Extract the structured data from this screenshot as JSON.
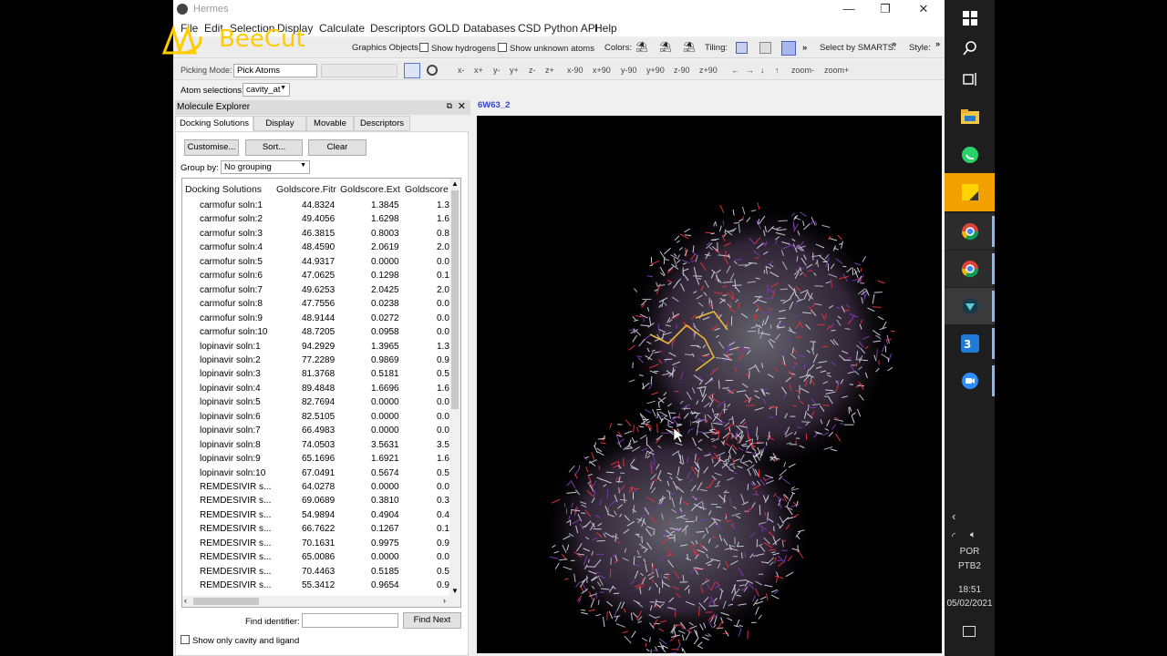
{
  "window": {
    "title": "Hermes",
    "minimize": "—",
    "maximize": "❐",
    "close": "✕"
  },
  "menu": [
    "File",
    "Edit",
    "Selection",
    "Display",
    "Calculate",
    "Descriptors",
    "GOLD",
    "Databases",
    "CSD Python API",
    "Help"
  ],
  "toolbar1": {
    "show_hydrogens": "Show hydrogens",
    "show_unknown_atoms": "Show unknown atoms",
    "graphics_objects": "Graphics Objects",
    "colors": "Colors:",
    "tiling": "Tiling:",
    "select_smarts": "Select by SMARTS:",
    "style": "Style:",
    "more": "»"
  },
  "toolbar2": {
    "picking_mode_label": "Picking Mode:",
    "picking_mode_value": "Pick Atoms",
    "rotations": [
      "x-",
      "x+",
      "y-",
      "y+",
      "z-",
      "z+",
      "x-90",
      "x+90",
      "y-90",
      "y+90",
      "z-90",
      "z+90",
      "←",
      "→",
      "↓",
      "↑",
      "zoom-",
      "zoom+"
    ]
  },
  "atom_selections": {
    "label": "Atom selections:",
    "value": "cavity_at"
  },
  "molecule_explorer": {
    "title": "Molecule Explorer",
    "tabs": [
      "Docking Solutions",
      "Display",
      "Movable",
      "Descriptors"
    ],
    "buttons": {
      "customise": "Customise...",
      "sort": "Sort...",
      "clear": "Clear"
    },
    "group_by_label": "Group by:",
    "group_by_value": "No grouping",
    "columns": [
      "Docking Solutions",
      "Goldscore.Fitr",
      "Goldscore.Ext",
      "Goldscore"
    ],
    "rows": [
      [
        "carmofur soln:1",
        "44.8324",
        "1.3845",
        "1.3"
      ],
      [
        "carmofur soln:2",
        "49.4056",
        "1.6298",
        "1.6"
      ],
      [
        "carmofur soln:3",
        "46.3815",
        "0.8003",
        "0.8"
      ],
      [
        "carmofur soln:4",
        "48.4590",
        "2.0619",
        "2.0"
      ],
      [
        "carmofur soln:5",
        "44.9317",
        "0.0000",
        "0.0"
      ],
      [
        "carmofur soln:6",
        "47.0625",
        "0.1298",
        "0.1"
      ],
      [
        "carmofur soln:7",
        "49.6253",
        "2.0425",
        "2.0"
      ],
      [
        "carmofur soln:8",
        "47.7556",
        "0.0238",
        "0.0"
      ],
      [
        "carmofur soln:9",
        "48.9144",
        "0.0272",
        "0.0"
      ],
      [
        "carmofur soln:10",
        "48.7205",
        "0.0958",
        "0.0"
      ],
      [
        "lopinavir soln:1",
        "94.2929",
        "1.3965",
        "1.3"
      ],
      [
        "lopinavir soln:2",
        "77.2289",
        "0.9869",
        "0.9"
      ],
      [
        "lopinavir soln:3",
        "81.3768",
        "0.5181",
        "0.5"
      ],
      [
        "lopinavir soln:4",
        "89.4848",
        "1.6696",
        "1.6"
      ],
      [
        "lopinavir soln:5",
        "82.7694",
        "0.0000",
        "0.0"
      ],
      [
        "lopinavir soln:6",
        "82.5105",
        "0.0000",
        "0.0"
      ],
      [
        "lopinavir soln:7",
        "66.4983",
        "0.0000",
        "0.0"
      ],
      [
        "lopinavir soln:8",
        "74.0503",
        "3.5631",
        "3.5"
      ],
      [
        "lopinavir soln:9",
        "65.1696",
        "1.6921",
        "1.6"
      ],
      [
        "lopinavir soln:10",
        "67.0491",
        "0.5674",
        "0.5"
      ],
      [
        "REMDESIVIR s...",
        "64.0278",
        "0.0000",
        "0.0"
      ],
      [
        "REMDESIVIR s...",
        "69.0689",
        "0.3810",
        "0.3"
      ],
      [
        "REMDESIVIR s...",
        "54.9894",
        "0.4904",
        "0.4"
      ],
      [
        "REMDESIVIR s...",
        "66.7622",
        "0.1267",
        "0.1"
      ],
      [
        "REMDESIVIR s...",
        "70.1631",
        "0.9975",
        "0.9"
      ],
      [
        "REMDESIVIR s...",
        "65.0086",
        "0.0000",
        "0.0"
      ],
      [
        "REMDESIVIR s...",
        "70.4463",
        "0.5185",
        "0.5"
      ],
      [
        "REMDESIVIR s...",
        "55.3412",
        "0.9654",
        "0.9"
      ]
    ],
    "find_identifier_label": "Find identifier:",
    "find_identifier_value": "",
    "find_next": "Find Next",
    "show_only_cavity": "Show only cavity and ligand"
  },
  "viewer": {
    "tab_label": "6W63_2"
  },
  "watermark": {
    "text": "BeeCut"
  },
  "taskbar": {
    "language": "POR",
    "layout": "PTB2",
    "time": "18:51",
    "date": "05/02/2021"
  }
}
